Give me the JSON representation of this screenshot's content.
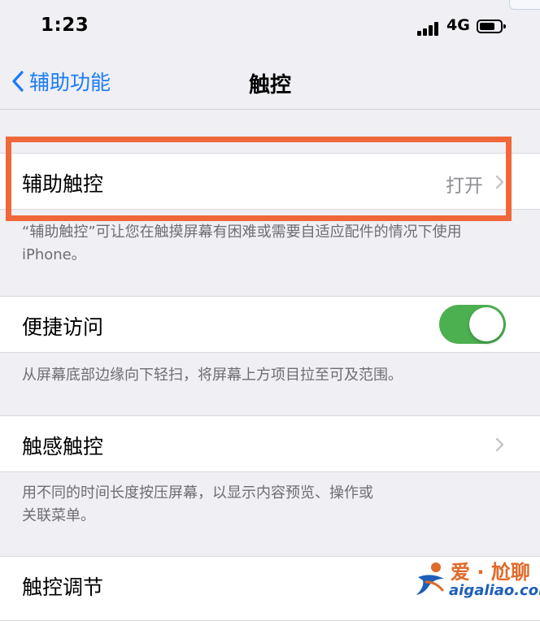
{
  "status": {
    "time": "1:23",
    "network": "4G"
  },
  "nav": {
    "back_label": "辅助功能",
    "title": "触控"
  },
  "assistive_touch": {
    "label": "辅助触控",
    "value": "打开"
  },
  "assistive_touch_footer": "“辅助触控”可让您在触摸屏幕有困难或需要自适应配件的情况下使用 iPhone。",
  "reachability": {
    "label": "便捷访问",
    "enabled": true
  },
  "reachability_footer": "从屏幕底部边缘向下轻扫，将屏幕上方项目拉至可及范围。",
  "haptic_touch": {
    "label": "触感触控"
  },
  "haptic_touch_footer_line1": "用不同的时间长度按压屏幕，以显示内容预览、操作或",
  "haptic_touch_footer_line2": "关联菜单。",
  "touch_accommodations": {
    "label": "触控调节"
  },
  "watermark": {
    "text": "爱 · 尬聊",
    "url": "aigaliao.com"
  },
  "colors": {
    "accent": "#1a7cf5",
    "toggle_on": "#4cb050",
    "highlight": "#f0683a"
  }
}
